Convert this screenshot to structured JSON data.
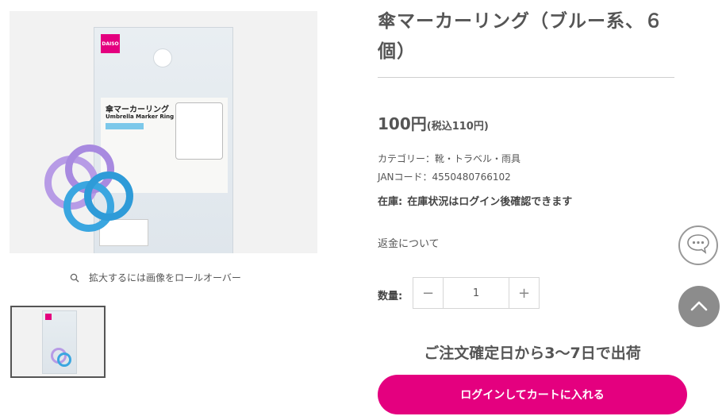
{
  "product": {
    "title": "傘マーカーリング（ブルー系、６個）",
    "price_amount": "100円",
    "price_tax": "(税込110円)",
    "category": "カテゴリー：靴・トラベル・雨具",
    "jan": "JANコード：4550480766102",
    "stock_label": "在庫:",
    "stock_value": "在庫状況はログイン後確認できます",
    "returns_link": "返金について"
  },
  "gallery": {
    "zoom_hint": "拡大するには画像をロールオーバー",
    "main_image_icon": "product-image",
    "package_brand": "DAISO",
    "package_name_jp": "傘マーカーリング",
    "package_name_en": "Umbrella Marker Ring"
  },
  "quantity": {
    "label": "数量:",
    "value": "1",
    "minus": "−",
    "plus": "+"
  },
  "shipping_note": "ご注文確定日から3〜7日で出荷",
  "cart_button": "ログインしてカートに入れる",
  "colors": {
    "accent": "#e4007f",
    "text": "#555555",
    "scroll_top_bg": "#8c8c8c"
  },
  "icons": {
    "zoom": "search-icon",
    "chat": "chat-bubble-icon",
    "scroll_top": "chevron-up-icon"
  }
}
